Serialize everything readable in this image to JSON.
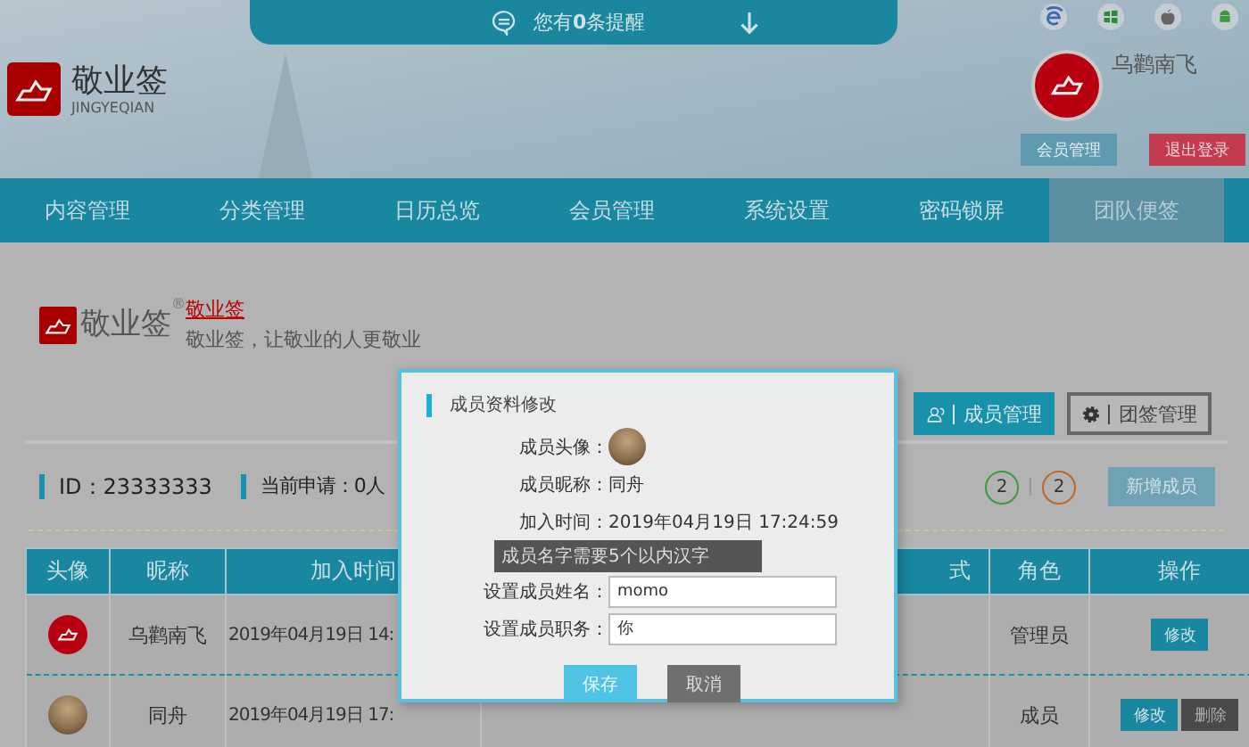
{
  "notice": {
    "text": "您有**0**条提醒"
  },
  "logo": {
    "name": "敬业签",
    "pinyin": "JINGYEQIAN"
  },
  "user": {
    "name": "乌鹳南飞",
    "buttons": [
      {
        "label": "会员管理",
        "kind": "primary"
      },
      {
        "label": "退出登录",
        "kind": "danger"
      }
    ]
  },
  "nav": [
    {
      "label": "内容管理",
      "selected": false
    },
    {
      "label": "分类管理",
      "selected": false
    },
    {
      "label": "日历总览",
      "selected": false
    },
    {
      "label": "会员管理",
      "selected": false
    },
    {
      "label": "系统设置",
      "selected": false
    },
    {
      "label": "密码锁屏",
      "selected": false
    },
    {
      "label": "团队便签",
      "selected": true
    }
  ],
  "team": {
    "logo_text": "敬业签",
    "mark": "®",
    "title": "敬业签",
    "slogan": "敬业签，让敬业的人更敬业",
    "tabs": [
      {
        "label": "成员管理",
        "selected": true
      },
      {
        "label": "团签管理",
        "selected": false
      }
    ]
  },
  "stats": {
    "id": "ID：23333333",
    "applications": "当前申请：0人",
    "counts": [
      {
        "value": "2",
        "color": "#3d9a3d"
      },
      {
        "value": "2",
        "color": "#c0662a"
      }
    ],
    "add_button": "新增成员"
  },
  "table": {
    "columns": [
      "头像",
      "昵称",
      "加入时间",
      "式",
      "角色",
      "操作"
    ],
    "rows": [
      {
        "kind": "admin",
        "nickname": "乌鹳南飞",
        "joined": "2019年04月19日 14:",
        "role": "管理员",
        "actions": [
          {
            "label": "修改",
            "kind": "edit"
          }
        ]
      },
      {
        "kind": "member",
        "nickname": "同舟",
        "joined": "2019年04月19日 17:",
        "role": "成员",
        "actions": [
          {
            "label": "修改",
            "kind": "edit"
          },
          {
            "label": "删除",
            "kind": "delete"
          }
        ]
      }
    ]
  },
  "dialog": {
    "title": "成员资料修改",
    "fields": [
      {
        "kind": "avatar",
        "label": "成员头像："
      },
      {
        "kind": "text",
        "label": "成员昵称：",
        "value": "同舟"
      },
      {
        "kind": "text",
        "label": "加入时间：",
        "value": "2019年04月19日 17:24:59"
      },
      {
        "kind": "hint",
        "text": "成员名字需要5个以内汉字"
      },
      {
        "kind": "input",
        "label": "设置成员姓名：",
        "value": "momo"
      },
      {
        "kind": "input",
        "label": "设置成员职务：",
        "value": "你"
      }
    ],
    "buttons": [
      {
        "label": "保存",
        "kind": "primary"
      },
      {
        "label": "取消",
        "kind": "secondary"
      }
    ]
  }
}
